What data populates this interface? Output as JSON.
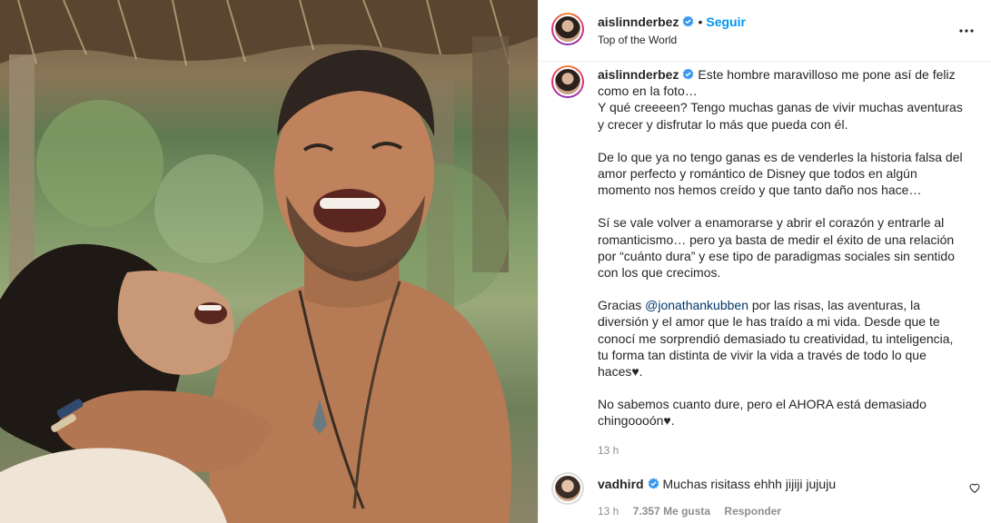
{
  "post": {
    "username": "aislinnderbez",
    "follow_label": "Seguir",
    "separator": "•",
    "location": "Top of the World",
    "more_icon": "more-options-icon"
  },
  "caption": {
    "username": "aislinnderbez",
    "p1": "Este hombre maravilloso me pone así de feliz\ncomo en la foto…\nY qué creeeen? Tengo muchas ganas de vivir muchas aventuras\ny crecer y disfrutar lo más que pueda con él.",
    "p2": "De lo que ya no tengo ganas es de venderles la historia falsa del\namor perfecto y romántico de Disney que todos en algún\nmomento nos hemos creído y que tanto daño nos hace…",
    "p3": "Sí se vale volver a enamorarse y abrir el corazón y entrarle al\nromanticismo… pero ya basta de medir el éxito de una relación\npor “cuánto dura” y ese tipo de paradigmas sociales sin sentido\ncon los que crecimos.",
    "p4_pre": "Gracias ",
    "p4_mention": "@jonathankubben",
    "p4_post": " por las risas, las aventuras, la\ndiversión y el amor que le has traído a mi vida. Desde que te\nconocí me sorprendió demasiado tu creatividad, tu inteligencia,\ntu forma tan distinta de vivir la vida a través de todo lo que\nhaces♥.",
    "p5": "No sabemos cuanto dure, pero el AHORA está demasiado\nchingoooón♥.",
    "time": "13 h"
  },
  "comment": {
    "username": "vadhird",
    "text": "Muchas risitass ehhh jijiji jujuju",
    "time": "13 h",
    "likes": "7.357 Me gusta",
    "reply_label": "Responder"
  },
  "colors": {
    "accent": "#0095f6",
    "verified": "#3897f0",
    "text": "#262626",
    "muted": "#8e8e8e"
  }
}
